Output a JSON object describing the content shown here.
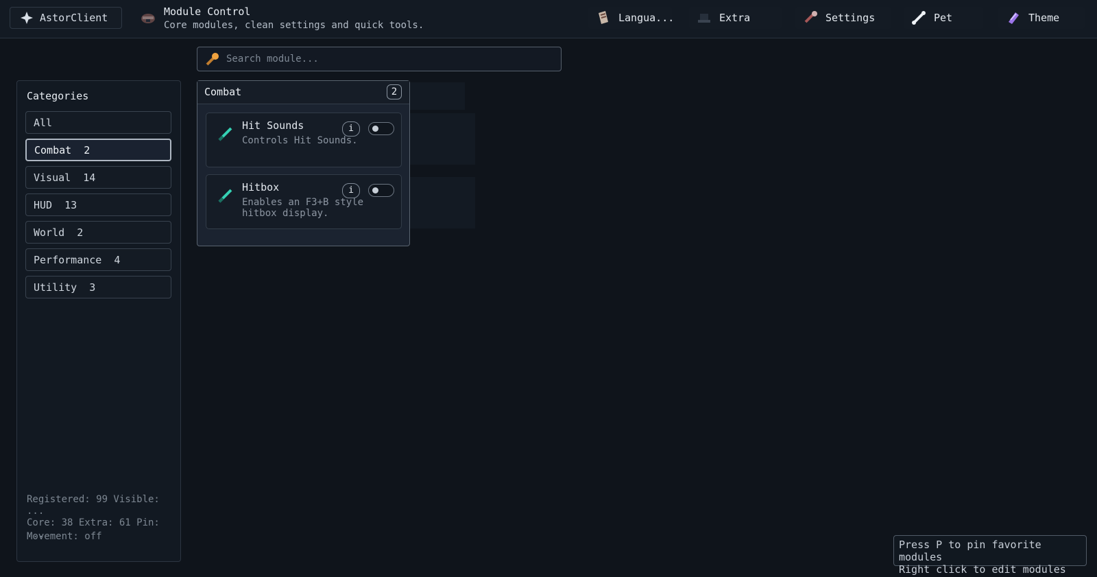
{
  "brand": {
    "name": "AstorClient"
  },
  "module_header": {
    "title": "Module Control",
    "subtitle": "Core modules, clean settings and quick tools."
  },
  "nav": [
    {
      "label": "Langua...",
      "icon": "book-icon"
    },
    {
      "label": "Extra",
      "icon": "hat-icon"
    },
    {
      "label": "Settings",
      "icon": "tool-icon"
    },
    {
      "label": "Pet",
      "icon": "bone-icon"
    },
    {
      "label": "Theme",
      "icon": "crystal-icon"
    }
  ],
  "search": {
    "placeholder": "Search module..."
  },
  "sidebar": {
    "title": "Categories",
    "categories": [
      {
        "label": "All",
        "active": false
      },
      {
        "label": "Combat  2",
        "active": true
      },
      {
        "label": "Visual  14",
        "active": false
      },
      {
        "label": "HUD  13",
        "active": false
      },
      {
        "label": "World  2",
        "active": false
      },
      {
        "label": "Performance  4",
        "active": false
      },
      {
        "label": "Utility  3",
        "active": false
      }
    ],
    "stats_line1": "Registered: 99 Visible: ...",
    "stats_line2": "Core: 38 Extra: 61 Pin: ...",
    "movement": "Movement: off"
  },
  "panel": {
    "title": "Combat",
    "count": "2",
    "modules": [
      {
        "name": "Hit Sounds",
        "description": "Controls Hit Sounds.",
        "info": "i",
        "enabled": false
      },
      {
        "name": "Hitbox",
        "description": "Enables an F3+B style hitbox display.",
        "info": "i",
        "enabled": false
      }
    ]
  },
  "tip": {
    "line1": "Press P to pin favorite modules",
    "line2": "Right click to edit modules"
  },
  "colors": {
    "background": "#0f141b",
    "panel": "#1b2330",
    "accent": "#35d1b4",
    "border_active": "#aeb7c2"
  }
}
